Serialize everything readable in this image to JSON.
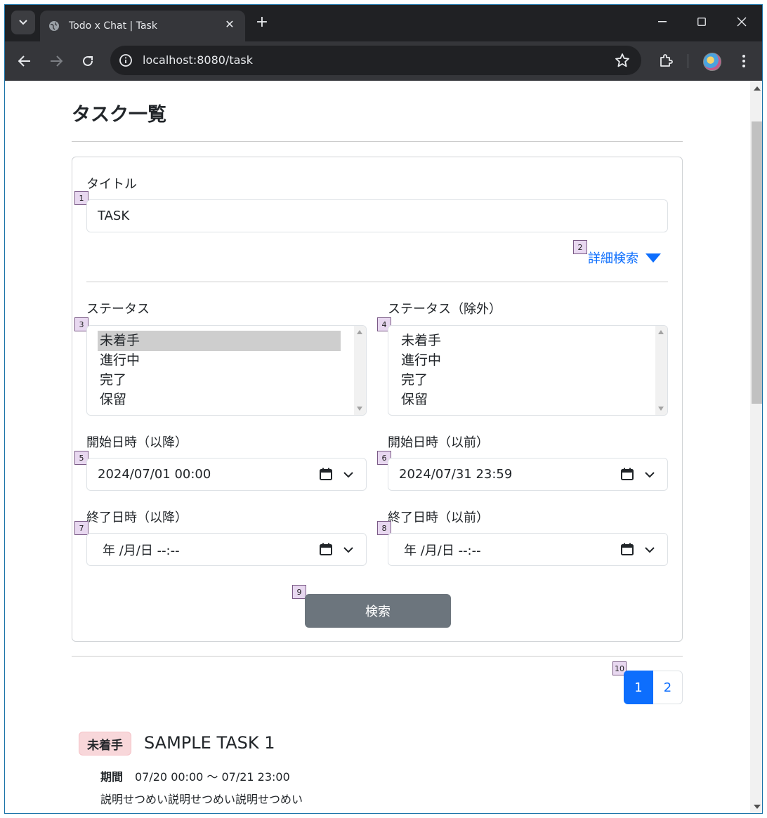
{
  "browser": {
    "tab_title": "Todo x Chat | Task",
    "url": "localhost:8080/task"
  },
  "page": {
    "title": "タスク一覧"
  },
  "form": {
    "title_label": "タイトル",
    "title_value": "TASK",
    "advanced_search_label": "詳細検索",
    "status_label": "ステータス",
    "status_exclude_label": "ステータス（除外）",
    "status_options": [
      "未着手",
      "進行中",
      "完了",
      "保留"
    ],
    "status_exclude_options": [
      "未着手",
      "進行中",
      "完了",
      "保留"
    ],
    "start_after_label": "開始日時（以降）",
    "start_after_value": "2024/07/01 00:00",
    "start_before_label": "開始日時（以前）",
    "start_before_value": "2024/07/31 23:59",
    "end_after_label": "終了日時（以降）",
    "end_after_value": "年 /月/日 --:--",
    "end_before_label": "終了日時（以前）",
    "end_before_value": "年 /月/日 --:--",
    "search_button": "検索"
  },
  "markers": [
    "1",
    "2",
    "3",
    "4",
    "5",
    "6",
    "7",
    "8",
    "9",
    "10"
  ],
  "pagination": {
    "pages": [
      "1",
      "2"
    ],
    "active": "1"
  },
  "task": {
    "status": "未着手",
    "title": "SAMPLE TASK 1",
    "period_label": "期間",
    "period": "07/20 00:00 〜 07/21 23:00",
    "description": "説明せつめい説明せつめい説明せつめい"
  }
}
